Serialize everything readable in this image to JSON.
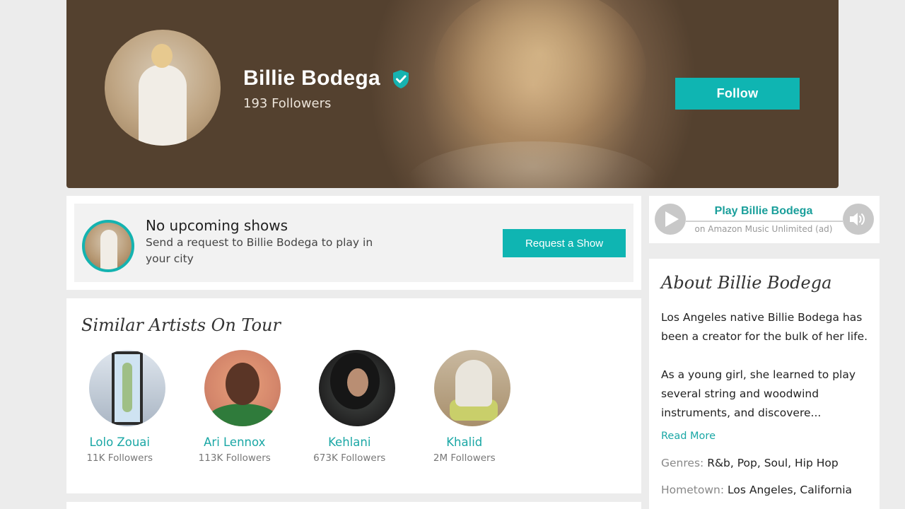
{
  "hero": {
    "artist_name": "Billie Bodega",
    "followers": "193 Followers",
    "follow_label": "Follow"
  },
  "shows": {
    "title": "No upcoming shows",
    "subtitle": "Send a request to Billie Bodega to play in your city",
    "request_label": "Request a Show"
  },
  "similar": {
    "title": "Similar Artists On Tour",
    "artists": [
      {
        "name": "Lolo Zouai",
        "followers": "11K Followers"
      },
      {
        "name": "Ari Lennox",
        "followers": "113K Followers"
      },
      {
        "name": "Kehlani",
        "followers": "673K Followers"
      },
      {
        "name": "Khalid",
        "followers": "2M Followers"
      }
    ]
  },
  "player": {
    "title": "Play Billie Bodega",
    "subtitle": "on Amazon Music Unlimited (ad)"
  },
  "about": {
    "title": "About Billie Bodega",
    "paragraph1": "Los Angeles native Billie Bodega has been a creator for the bulk of her life.",
    "paragraph2": "As a young girl, she learned to play several string and woodwind instruments, and discovere...",
    "read_more": "Read More",
    "genres_label": "Genres:",
    "genres_value": "R&b, Pop, Soul, Hip Hop",
    "hometown_label": "Hometown:",
    "hometown_value": "Los Angeles, California"
  },
  "colors": {
    "accent": "#0fb5b2",
    "link": "#1aa7a5",
    "hero_bg": "#5e4a37"
  }
}
